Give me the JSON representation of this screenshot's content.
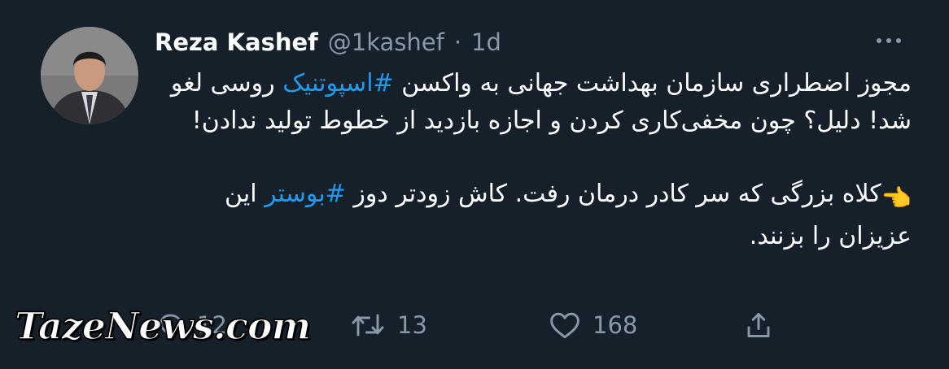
{
  "tweet": {
    "author_name": "Reza Kashef",
    "handle": "@1kashef",
    "separator": "·",
    "time": "1d",
    "body": {
      "line1_text": "مجوز اضطراری سازمان بهداشت جهانی به واکسن ",
      "line1_hashtag": "#اسپوتنیک",
      "line2_text": " روسی لغو شد! دلیل؟ چون مخفی‌کاری کردن و اجازه بازدید از خطوط تولید ندادن!",
      "line3_emoji": "👈",
      "line3_text": "کلاه بزرگی که سر کادر درمان رفت. کاش زودتر دوز ",
      "line3_hashtag": "#بوستر",
      "line3_tail": " این عزیزان را بزنند."
    }
  },
  "actions": {
    "reply_count": "12",
    "retweet_count": "13",
    "like_count": "168"
  },
  "icons": {
    "avatar": "avatar-photo",
    "more": "more-dots-icon",
    "reply": "reply-icon",
    "retweet": "retweet-icon",
    "like": "heart-icon",
    "share": "share-icon"
  },
  "colors": {
    "background": "#15202b",
    "text": "#ffffff",
    "muted": "#8899a6",
    "link": "#1d9bf0"
  },
  "watermark": "TazeNews.com"
}
